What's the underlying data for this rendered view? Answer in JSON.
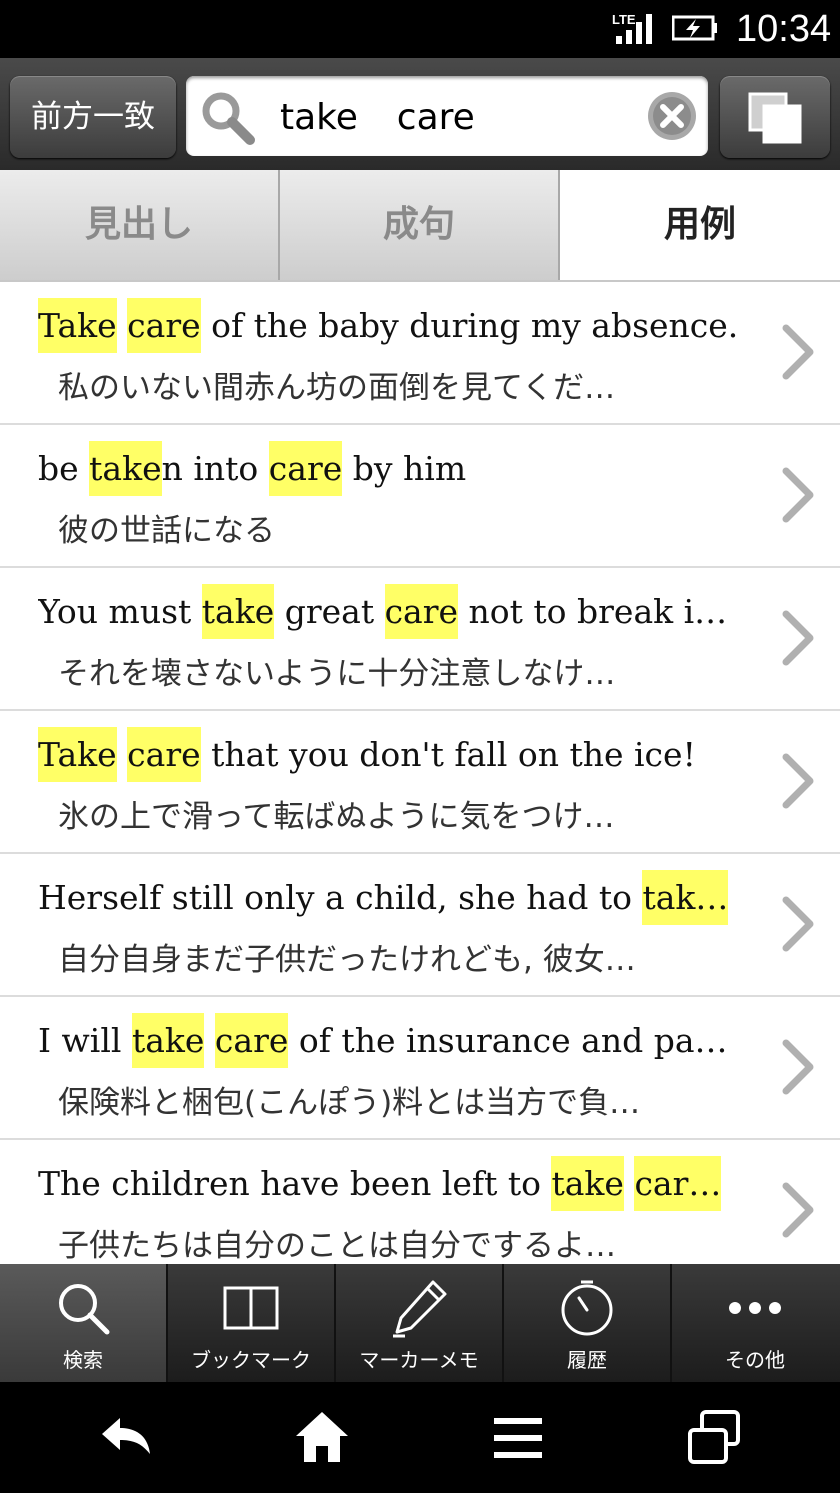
{
  "status_bar": {
    "network": "LTE",
    "time": "10:34"
  },
  "search": {
    "mode_label": "前方一致",
    "query": "take  care"
  },
  "tabs": [
    {
      "label": "見出し",
      "active": false
    },
    {
      "label": "成句",
      "active": false
    },
    {
      "label": "用例",
      "active": true
    }
  ],
  "results": [
    {
      "en": [
        [
          "Take",
          true
        ],
        [
          " ",
          false
        ],
        [
          "care",
          true
        ],
        [
          " of the baby during my absence.",
          false
        ]
      ],
      "ja": "私のいない間赤ん坊の面倒を見てくだ…"
    },
    {
      "en": [
        [
          "be ",
          false
        ],
        [
          "take",
          true
        ],
        [
          "n into ",
          false
        ],
        [
          "care",
          true
        ],
        [
          " by him",
          false
        ]
      ],
      "ja": "彼の世話になる"
    },
    {
      "en": [
        [
          "You must ",
          false
        ],
        [
          "take",
          true
        ],
        [
          " great ",
          false
        ],
        [
          "care",
          true
        ],
        [
          " not to break i…",
          false
        ]
      ],
      "ja": "それを壊さないように十分注意しなけ…"
    },
    {
      "en": [
        [
          "Take",
          true
        ],
        [
          " ",
          false
        ],
        [
          "care",
          true
        ],
        [
          " that you don't fall on the ice!",
          false
        ]
      ],
      "ja": "氷の上で滑って転ばぬように気をつけ…"
    },
    {
      "en": [
        [
          "Herself still only a child, she had to ",
          false
        ],
        [
          "tak…",
          true
        ]
      ],
      "ja": "自分自身まだ子供だったけれども, 彼女…"
    },
    {
      "en": [
        [
          "I will ",
          false
        ],
        [
          "take",
          true
        ],
        [
          " ",
          false
        ],
        [
          "care",
          true
        ],
        [
          " of the insurance and pa…",
          false
        ]
      ],
      "ja": "保険料と梱包(こんぽう)料とは当方で負…"
    },
    {
      "en": [
        [
          "The children have been left to ",
          false
        ],
        [
          "take",
          true
        ],
        [
          " ",
          false
        ],
        [
          "car…",
          true
        ]
      ],
      "ja": "子供たちは自分のことは自分でするよ…"
    }
  ],
  "bottom_nav": [
    {
      "label": "検索",
      "icon": "search-icon",
      "active": true
    },
    {
      "label": "ブックマーク",
      "icon": "book-icon",
      "active": false
    },
    {
      "label": "マーカーメモ",
      "icon": "pen-icon",
      "active": false
    },
    {
      "label": "履歴",
      "icon": "clock-icon",
      "active": false
    },
    {
      "label": "その他",
      "icon": "more-icon",
      "active": false
    }
  ],
  "colors": {
    "highlight": "#ffff66",
    "status_bg": "#000000",
    "toolbar_bg": "#3a3a3a"
  }
}
